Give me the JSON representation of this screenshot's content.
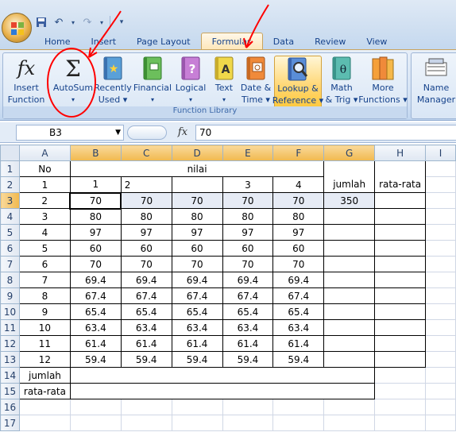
{
  "app": {
    "quick_access": [
      "save-icon",
      "undo-icon",
      "redo-icon",
      "customize-icon"
    ],
    "tabs": [
      "Home",
      "Insert",
      "Page Layout",
      "Formulas",
      "Data",
      "Review",
      "View"
    ],
    "active_tab": "Formulas"
  },
  "ribbon": {
    "function_library": {
      "label": "Function Library",
      "buttons": [
        {
          "line1": "Insert",
          "line2": "Function"
        },
        {
          "line1": "AutoSum",
          "line2": "▾"
        },
        {
          "line1": "Recently",
          "line2": "Used ▾"
        },
        {
          "line1": "Financial",
          "line2": "▾"
        },
        {
          "line1": "Logical",
          "line2": "▾"
        },
        {
          "line1": "Text",
          "line2": "▾"
        },
        {
          "line1": "Date &",
          "line2": "Time ▾"
        },
        {
          "line1": "Lookup &",
          "line2": "Reference ▾"
        },
        {
          "line1": "Math",
          "line2": "& Trig ▾"
        },
        {
          "line1": "More",
          "line2": "Functions ▾"
        }
      ]
    },
    "names": {
      "line1": "Name",
      "line2": "Manager"
    }
  },
  "formula_bar": {
    "name_box": "B3",
    "fx": "fx",
    "value": "70"
  },
  "sheet": {
    "columns": [
      "A",
      "B",
      "C",
      "D",
      "E",
      "F",
      "G",
      "H",
      "I"
    ],
    "selected_column_letters": [
      "B",
      "C",
      "D",
      "E",
      "F",
      "G"
    ],
    "row_numbers": [
      "1",
      "2",
      "3",
      "4",
      "5",
      "6",
      "7",
      "8",
      "9",
      "10",
      "11",
      "12",
      "13",
      "14",
      "15",
      "16",
      "17"
    ],
    "header_row1": {
      "no": "No",
      "nilai": "nilai"
    },
    "header_row2": {
      "a": "1",
      "b": "1",
      "c": "2",
      "d": "",
      "e": "3",
      "f": "4",
      "jumlah": "jumlah",
      "rata": "rata-rata"
    },
    "data_rows": [
      {
        "no": "2",
        "v": [
          "70",
          "70",
          "70",
          "70",
          "70"
        ],
        "jumlah": "350"
      },
      {
        "no": "3",
        "v": [
          "80",
          "80",
          "80",
          "80",
          "80"
        ],
        "jumlah": ""
      },
      {
        "no": "4",
        "v": [
          "97",
          "97",
          "97",
          "97",
          "97"
        ],
        "jumlah": ""
      },
      {
        "no": "5",
        "v": [
          "60",
          "60",
          "60",
          "60",
          "60"
        ],
        "jumlah": ""
      },
      {
        "no": "6",
        "v": [
          "70",
          "70",
          "70",
          "70",
          "70"
        ],
        "jumlah": ""
      },
      {
        "no": "7",
        "v": [
          "69.4",
          "69.4",
          "69.4",
          "69.4",
          "69.4"
        ],
        "jumlah": ""
      },
      {
        "no": "8",
        "v": [
          "67.4",
          "67.4",
          "67.4",
          "67.4",
          "67.4"
        ],
        "jumlah": ""
      },
      {
        "no": "9",
        "v": [
          "65.4",
          "65.4",
          "65.4",
          "65.4",
          "65.4"
        ],
        "jumlah": ""
      },
      {
        "no": "10",
        "v": [
          "63.4",
          "63.4",
          "63.4",
          "63.4",
          "63.4"
        ],
        "jumlah": ""
      },
      {
        "no": "11",
        "v": [
          "61.4",
          "61.4",
          "61.4",
          "61.4",
          "61.4"
        ],
        "jumlah": ""
      },
      {
        "no": "12",
        "v": [
          "59.4",
          "59.4",
          "59.4",
          "59.4",
          "59.4"
        ],
        "jumlah": ""
      }
    ],
    "footer": {
      "jumlah": "jumlah",
      "rata": "rata-rata"
    }
  },
  "colors": {
    "annotation": "#ff0000",
    "accent": "#ffc83a",
    "ribbon": "#d3e2f4"
  }
}
